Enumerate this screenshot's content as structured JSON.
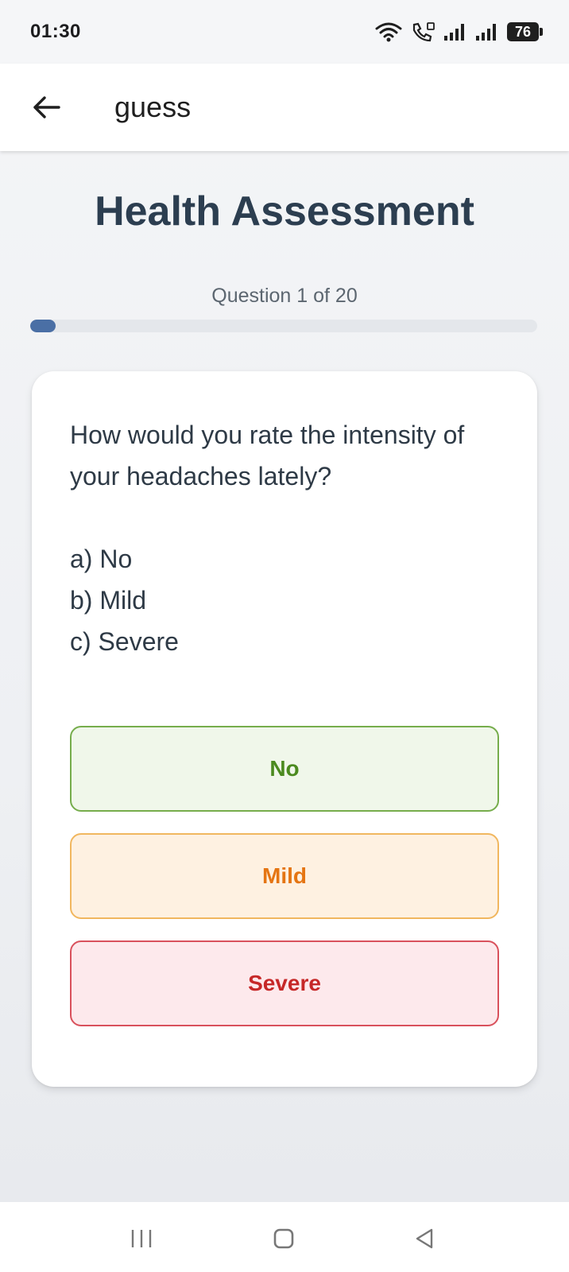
{
  "status_bar": {
    "time": "01:30",
    "battery": "76",
    "icons": [
      "wifi-icon",
      "call-icon",
      "signal-icon",
      "signal-icon",
      "battery-icon"
    ]
  },
  "app_bar": {
    "title": "guess",
    "back_icon": "arrow-left-icon"
  },
  "main": {
    "title": "Health Assessment",
    "progress_text": "Question 1 of 20",
    "progress_fraction": 0.05,
    "question": "How would you rate the intensity of your headaches lately?",
    "choices": [
      "a) No",
      "b) Mild",
      "c) Severe"
    ],
    "answers": [
      {
        "label": "No",
        "color": "#4b8a1f",
        "bg": "#f0f7ea",
        "border": "#76ad4c"
      },
      {
        "label": "Mild",
        "color": "#e57512",
        "bg": "#fef1e1",
        "border": "#f1b75f"
      },
      {
        "label": "Severe",
        "color": "#c62828",
        "bg": "#fde9ec",
        "border": "#d9515c"
      }
    ]
  },
  "nav_bar": {
    "icons": [
      "recents-icon",
      "home-icon",
      "back-triangle-icon"
    ]
  },
  "colors": {
    "title": "#2c3e50",
    "progress_fill": "#4a6fa5"
  }
}
